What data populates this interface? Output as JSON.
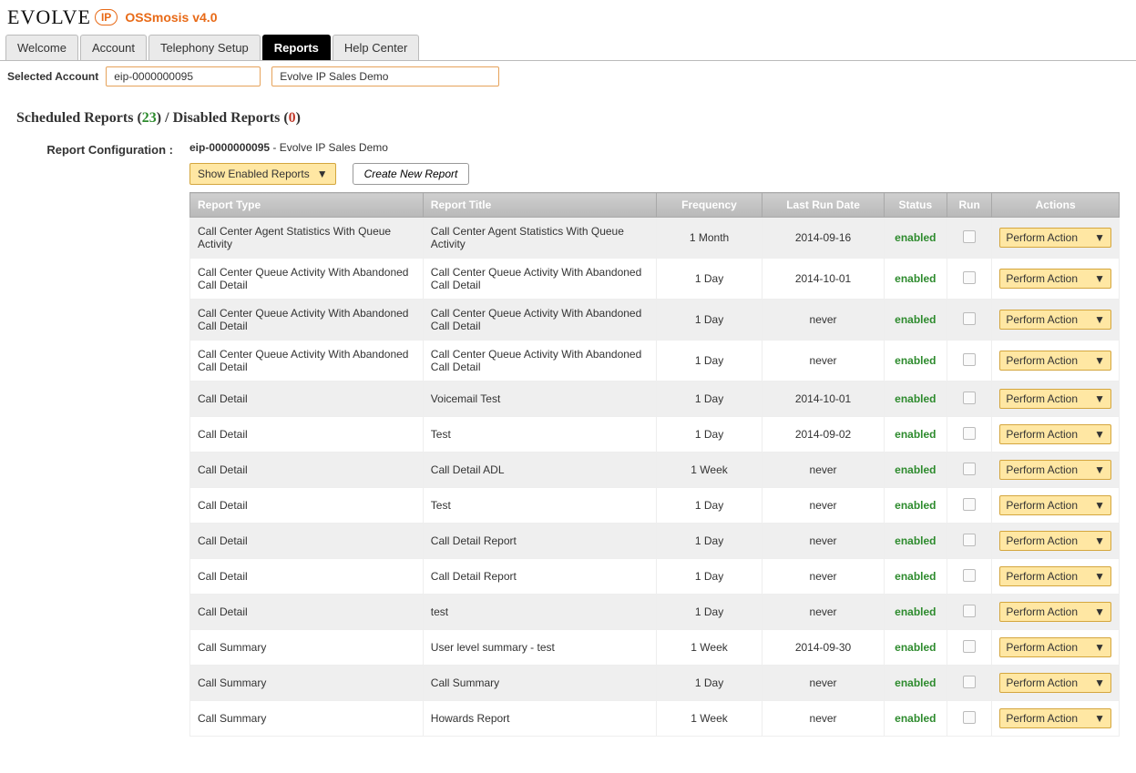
{
  "brand": {
    "name": "EVOLVE",
    "ip": "IP",
    "product": "OSSmosis v4.0"
  },
  "nav": {
    "tabs": [
      {
        "label": "Welcome"
      },
      {
        "label": "Account"
      },
      {
        "label": "Telephony Setup"
      },
      {
        "label": "Reports"
      },
      {
        "label": "Help Center"
      }
    ],
    "active_index": 3
  },
  "account": {
    "label": "Selected Account",
    "id": "eip-0000000095",
    "name": "Evolve IP Sales Demo"
  },
  "title": {
    "scheduled_label": "Scheduled Reports (",
    "scheduled_count": "23",
    "scheduled_close": ") / ",
    "disabled_label": "Disabled Reports (",
    "disabled_count": "0",
    "disabled_close": ")"
  },
  "config": {
    "left_label": "Report Configuration :",
    "account_id": "eip-0000000095",
    "sep": " - ",
    "account_name": "Evolve IP Sales Demo",
    "filter_label": "Show Enabled Reports",
    "create_label": "Create New Report"
  },
  "grid": {
    "headers": {
      "type": "Report Type",
      "title": "Report Title",
      "freq": "Frequency",
      "last": "Last Run Date",
      "status": "Status",
      "run": "Run",
      "actions": "Actions"
    },
    "action_label": "Perform Action",
    "rows": [
      {
        "type": "Call Center Agent Statistics With Queue Activity",
        "title": "Call Center Agent Statistics With Queue Activity",
        "freq": "1 Month",
        "last": "2014-09-16",
        "status": "enabled"
      },
      {
        "type": "Call Center Queue Activity With Abandoned Call Detail",
        "title": "Call Center Queue Activity With Abandoned Call Detail",
        "freq": "1 Day",
        "last": "2014-10-01",
        "status": "enabled"
      },
      {
        "type": "Call Center Queue Activity With Abandoned Call Detail",
        "title": "Call Center Queue Activity With Abandoned Call Detail",
        "freq": "1 Day",
        "last": "never",
        "status": "enabled"
      },
      {
        "type": "Call Center Queue Activity With Abandoned Call Detail",
        "title": "Call Center Queue Activity With Abandoned Call Detail",
        "freq": "1 Day",
        "last": "never",
        "status": "enabled"
      },
      {
        "type": "Call Detail",
        "title": "Voicemail Test",
        "freq": "1 Day",
        "last": "2014-10-01",
        "status": "enabled"
      },
      {
        "type": "Call Detail",
        "title": "Test",
        "freq": "1 Day",
        "last": "2014-09-02",
        "status": "enabled"
      },
      {
        "type": "Call Detail",
        "title": "Call Detail ADL",
        "freq": "1 Week",
        "last": "never",
        "status": "enabled"
      },
      {
        "type": "Call Detail",
        "title": "Test",
        "freq": "1 Day",
        "last": "never",
        "status": "enabled"
      },
      {
        "type": "Call Detail",
        "title": "Call Detail Report",
        "freq": "1 Day",
        "last": "never",
        "status": "enabled"
      },
      {
        "type": "Call Detail",
        "title": "Call Detail Report",
        "freq": "1 Day",
        "last": "never",
        "status": "enabled"
      },
      {
        "type": "Call Detail",
        "title": "test",
        "freq": "1 Day",
        "last": "never",
        "status": "enabled"
      },
      {
        "type": "Call Summary",
        "title": "User level summary - test",
        "freq": "1 Week",
        "last": "2014-09-30",
        "status": "enabled"
      },
      {
        "type": "Call Summary",
        "title": "Call Summary",
        "freq": "1 Day",
        "last": "never",
        "status": "enabled"
      },
      {
        "type": "Call Summary",
        "title": "Howards Report",
        "freq": "1 Week",
        "last": "never",
        "status": "enabled"
      }
    ]
  }
}
